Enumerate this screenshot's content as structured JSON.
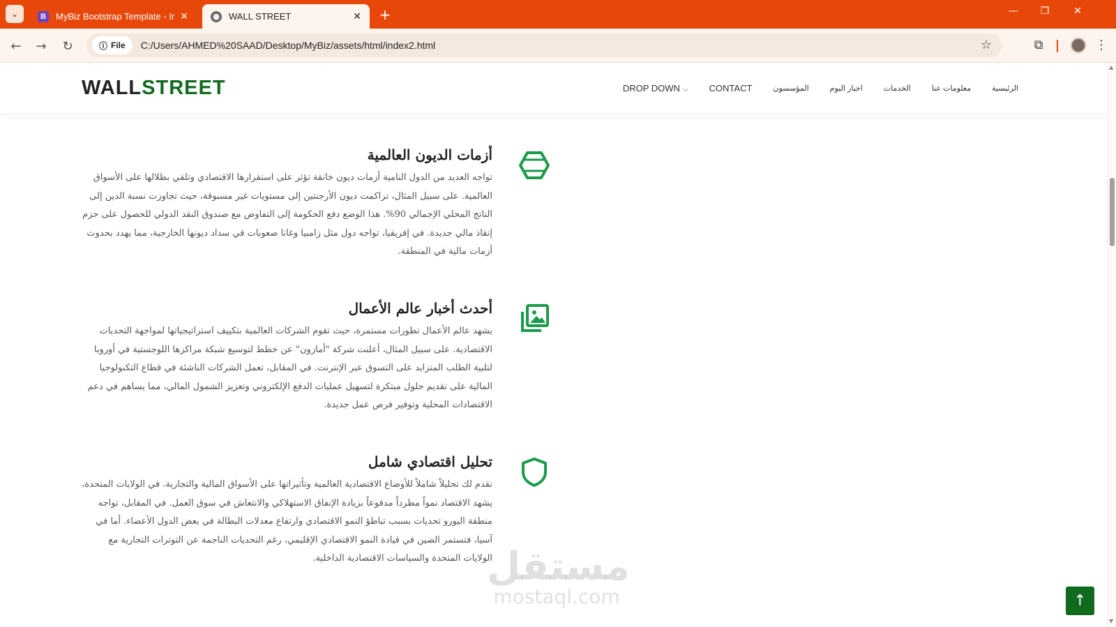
{
  "browser": {
    "tabs": [
      {
        "favicon": "B",
        "title": "MyBiz Bootstrap Template - Ind",
        "close": "✕"
      },
      {
        "favicon": "◉",
        "title": "WALL STREET",
        "close": "✕"
      }
    ],
    "new_tab": "+",
    "window_controls": [
      "—",
      "❐",
      "✕"
    ],
    "file_chip": "File",
    "url": "C:/Users/AHMED%20SAAD/Desktop/MyBiz/assets/html/index2.html"
  },
  "header": {
    "logo_part1": "WALL",
    "logo_part2": "STREET",
    "nav": [
      {
        "label": "DROP DOWN",
        "chevron": "⌵"
      },
      {
        "label": "CONTACT"
      },
      {
        "label": "المؤسسون"
      },
      {
        "label": "اخبار اليوم"
      },
      {
        "label": "الخدمات"
      },
      {
        "label": "معلومات عنا"
      },
      {
        "label": "الرئيسية"
      }
    ]
  },
  "features": [
    {
      "title": "أزمات الديون العالمية",
      "text": "تواجه العديد من الدول النامية أزمات ديون خانقة تؤثر على استقرارها الاقتصادي وتلقي بظلالها على الأسواق العالمية. على سبيل المثال، تراكمت ديون الأرجنتين إلى مستويات غير مسبوقة، حيث تجاوزت نسبة الدين إلى الناتج المحلي الإجمالي 90%. هذا الوضع دفع الحكومة إلى التفاوض مع صندوق النقد الدولي للحصول على حزم إنقاذ مالي جديدة. في إفريقيا، تواجه دول مثل زامبيا وغانا صعوبات في سداد ديونها الخارجية، مما يهدد بحدوث أزمات مالية في المنطقة."
    },
    {
      "title": "أحدث أخبار عالم الأعمال",
      "text": "يشهد عالم الأعمال تطورات مستمرة، حيث تقوم الشركات العالمية بتكييف استراتيجياتها لمواجهة التحديات الاقتصادية. على سبيل المثال، أعلنت شركة \"أمازون\" عن خطط لتوسيع شبكة مراكزها اللوجستية في أوروبا لتلبية الطلب المتزايد على التسوق عبر الإنترنت. في المقابل، تعمل الشركات الناشئة في قطاع التكنولوجيا المالية على تقديم حلول مبتكرة لتسهيل عمليات الدفع الإلكتروني وتعزيز الشمول المالي، مما يساهم في دعم الاقتصادات المحلية وتوفير فرص عمل جديدة."
    },
    {
      "title": "تحليل اقتصادي شامل",
      "text": "نقدم لك تحليلاً شاملاً للأوضاع الاقتصادية العالمية وتأثيراتها على الأسواق المالية والتجارية. في الولايات المتحدة، يشهد الاقتصاد نمواً مطرداً مدفوعاً بزيادة الإنفاق الاستهلاكي والانتعاش في سوق العمل. في المقابل، تواجه منطقة اليورو تحديات بسبب تباطؤ النمو الاقتصادي وارتفاع معدلات البطالة في بعض الدول الأعضاء. أما في آسيا، فتستمر الصين في قيادة النمو الاقتصادي الإقليمي، رغم التحديات الناجمة عن التوترات التجارية مع الولايات المتحدة والسياسات الاقتصادية الداخلية."
    }
  ],
  "icons": [
    "hexagon-icon",
    "images-icon",
    "shield-icon"
  ],
  "watermark": {
    "arabic": "مستقل",
    "latin": "mostaql.com"
  },
  "back_to_top": "↑",
  "colors": {
    "chrome": "#e8470a",
    "brand_green": "#106b1e",
    "icon_green": "#1a9b4a"
  }
}
